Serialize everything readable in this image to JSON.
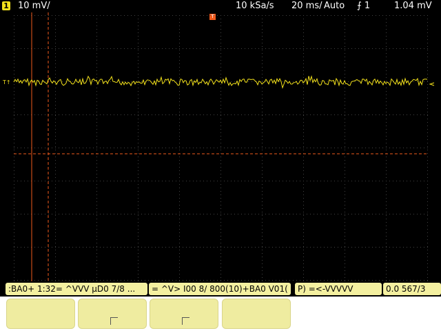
{
  "header": {
    "channel_number": "1",
    "vertical_scale": "10 mV/",
    "sample_rate": "10 kSa/s",
    "timebase": "20 ms/",
    "trigger_mode": "Auto",
    "trigger_source": "1",
    "trigger_level": "1.04 mV"
  },
  "markers": {
    "trigger_icon": "T"
  },
  "colors": {
    "trace": "#f4e21b",
    "cursor": "#f05a1c",
    "grid_dots": "#555555"
  },
  "status": {
    "segment_left": ":BA0+ 1:32= ^VVV μD0 7/8 ...",
    "segment_mid": "= ^V> I00 8/ 800(10)+BA0 V01( ",
    "segment_right": "P) =<-VVVVV",
    "segment_end": "0.0 567/3"
  },
  "softkeys": [
    {
      "label": ""
    },
    {
      "label": ""
    },
    {
      "label": ""
    },
    {
      "label": ""
    }
  ]
}
